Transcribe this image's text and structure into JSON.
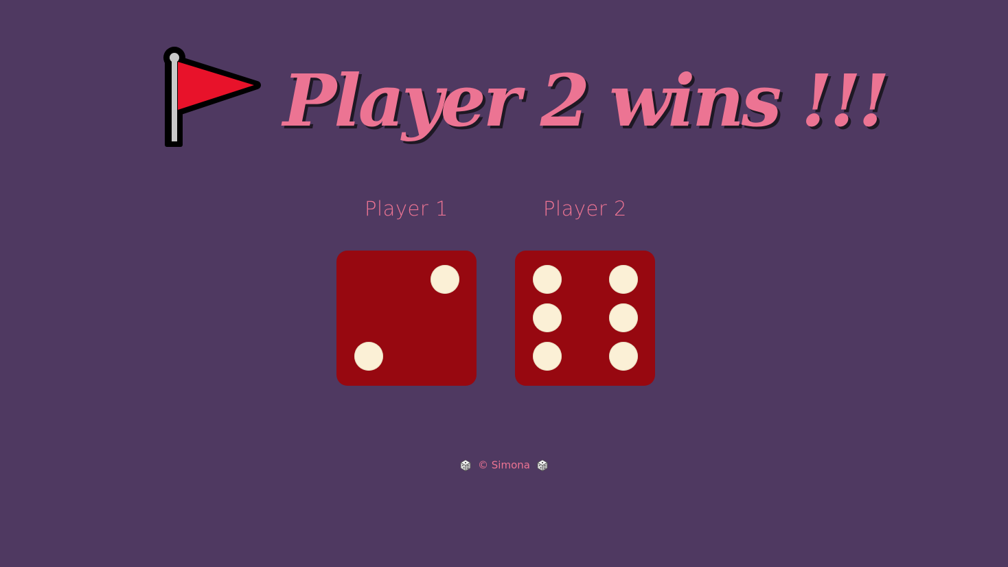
{
  "headline": "Player 2 wins !!!",
  "winner_icon": "red-flag-icon",
  "players": [
    {
      "label": "Player 1",
      "die_value": 2
    },
    {
      "label": "Player 2",
      "die_value": 6
    }
  ],
  "footer": {
    "text": "© Simona",
    "left_icon": "die-icon",
    "right_icon": "die-icon"
  },
  "colors": {
    "background": "#4f3961",
    "accent": "#ec7493",
    "die_face": "#970810",
    "pip": "#fbf0d6",
    "flag": "#e8122a"
  }
}
